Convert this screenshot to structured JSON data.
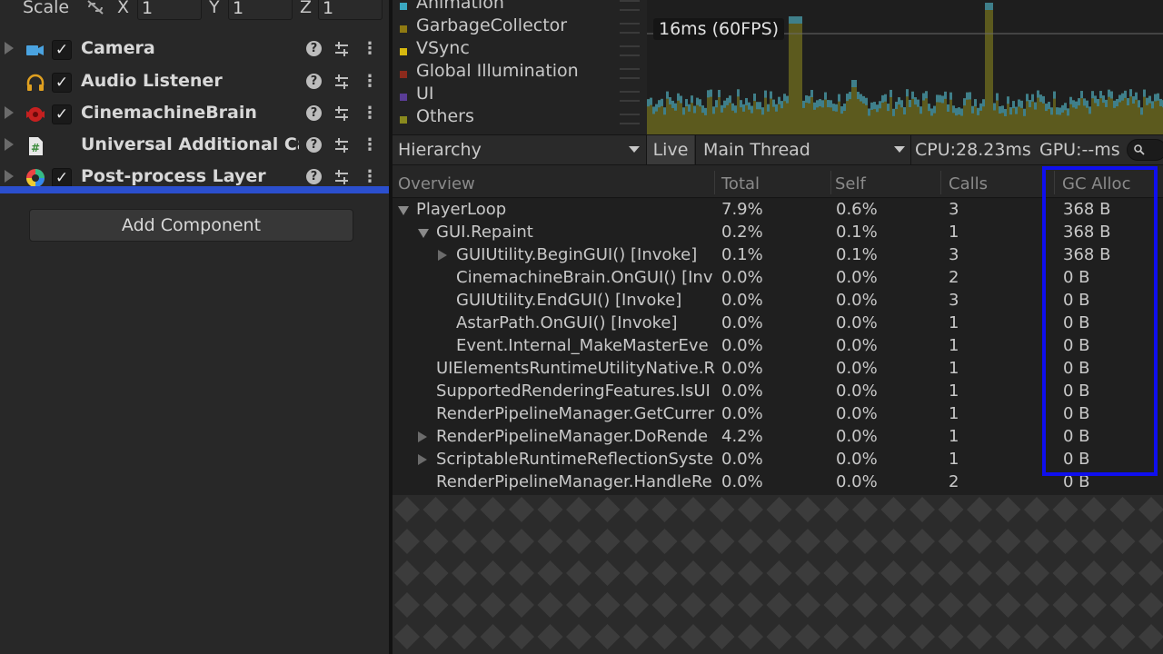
{
  "inspector": {
    "scale": {
      "label": "Scale",
      "x_label": "X",
      "x_value": "1",
      "y_label": "Y",
      "y_value": "1",
      "z_label": "Z",
      "z_value": "1"
    },
    "components": [
      {
        "name": "Camera",
        "icon": "camera-icon",
        "checked": true,
        "foldable": true
      },
      {
        "name": "Audio Listener",
        "icon": "headphones-icon",
        "checked": true,
        "foldable": false
      },
      {
        "name": "CinemachineBrain",
        "icon": "cinemachine-icon",
        "checked": true,
        "foldable": true
      },
      {
        "name": "Universal Additional Cam",
        "icon": "script-icon",
        "checked": false,
        "foldable": true
      },
      {
        "name": "Post-process Layer",
        "icon": "post-process-icon",
        "checked": true,
        "foldable": true
      }
    ],
    "help_glyph": "?",
    "more_glyph": "⋮",
    "check_glyph": "✓",
    "add_component_label": "Add Component"
  },
  "profiler": {
    "legend": [
      {
        "label": "Animation",
        "color": "#3aa8c1"
      },
      {
        "label": "GarbageCollector",
        "color": "#8f7a12"
      },
      {
        "label": "VSync",
        "color": "#d6b80f"
      },
      {
        "label": "Global Illumination",
        "color": "#8c2a1c"
      },
      {
        "label": "UI",
        "color": "#5a3d96"
      },
      {
        "label": "Others",
        "color": "#8a8a1e"
      }
    ],
    "fps_label": "16ms (60FPS)",
    "toolbar": {
      "view": "Hierarchy",
      "live": "Live",
      "thread": "Main Thread",
      "cpu": "CPU:28.23ms",
      "gpu": "GPU:--ms"
    },
    "columns": {
      "overview": "Overview",
      "total": "Total",
      "self": "Self",
      "calls": "Calls",
      "gc_alloc": "GC Alloc"
    },
    "rows": [
      {
        "name": "PlayerLoop",
        "indent": 0,
        "expander": "down",
        "total": "7.9%",
        "self": "0.6%",
        "calls": "3",
        "gc": "368 B"
      },
      {
        "name": "GUI.Repaint",
        "indent": 1,
        "expander": "down",
        "total": "0.2%",
        "self": "0.1%",
        "calls": "1",
        "gc": "368 B"
      },
      {
        "name": "GUIUtility.BeginGUI() [Invoke]",
        "indent": 2,
        "expander": "right",
        "total": "0.1%",
        "self": "0.1%",
        "calls": "3",
        "gc": "368 B"
      },
      {
        "name": "CinemachineBrain.OnGUI() [Inv",
        "indent": 2,
        "expander": "none",
        "total": "0.0%",
        "self": "0.0%",
        "calls": "2",
        "gc": "0 B"
      },
      {
        "name": "GUIUtility.EndGUI() [Invoke]",
        "indent": 2,
        "expander": "none",
        "total": "0.0%",
        "self": "0.0%",
        "calls": "3",
        "gc": "0 B"
      },
      {
        "name": "AstarPath.OnGUI() [Invoke]",
        "indent": 2,
        "expander": "none",
        "total": "0.0%",
        "self": "0.0%",
        "calls": "1",
        "gc": "0 B"
      },
      {
        "name": "Event.Internal_MakeMasterEve",
        "indent": 2,
        "expander": "none",
        "total": "0.0%",
        "self": "0.0%",
        "calls": "1",
        "gc": "0 B"
      },
      {
        "name": "UIElementsRuntimeUtilityNative.R",
        "indent": 1,
        "expander": "none",
        "total": "0.0%",
        "self": "0.0%",
        "calls": "1",
        "gc": "0 B"
      },
      {
        "name": "SupportedRenderingFeatures.IsUI",
        "indent": 1,
        "expander": "none",
        "total": "0.0%",
        "self": "0.0%",
        "calls": "1",
        "gc": "0 B"
      },
      {
        "name": "RenderPipelineManager.GetCurrer",
        "indent": 1,
        "expander": "none",
        "total": "0.0%",
        "self": "0.0%",
        "calls": "1",
        "gc": "0 B"
      },
      {
        "name": "RenderPipelineManager.DoRende",
        "indent": 1,
        "expander": "right",
        "total": "4.2%",
        "self": "0.0%",
        "calls": "1",
        "gc": "0 B"
      },
      {
        "name": "ScriptableRuntimeReflectionSyste",
        "indent": 1,
        "expander": "right",
        "total": "0.0%",
        "self": "0.0%",
        "calls": "1",
        "gc": "0 B"
      },
      {
        "name": "RenderPipelineManager.HandleRe",
        "indent": 1,
        "expander": "none",
        "total": "0.0%",
        "self": "0.0%",
        "calls": "2",
        "gc": "0 B"
      }
    ],
    "highlight_color": "#0f0fee"
  }
}
